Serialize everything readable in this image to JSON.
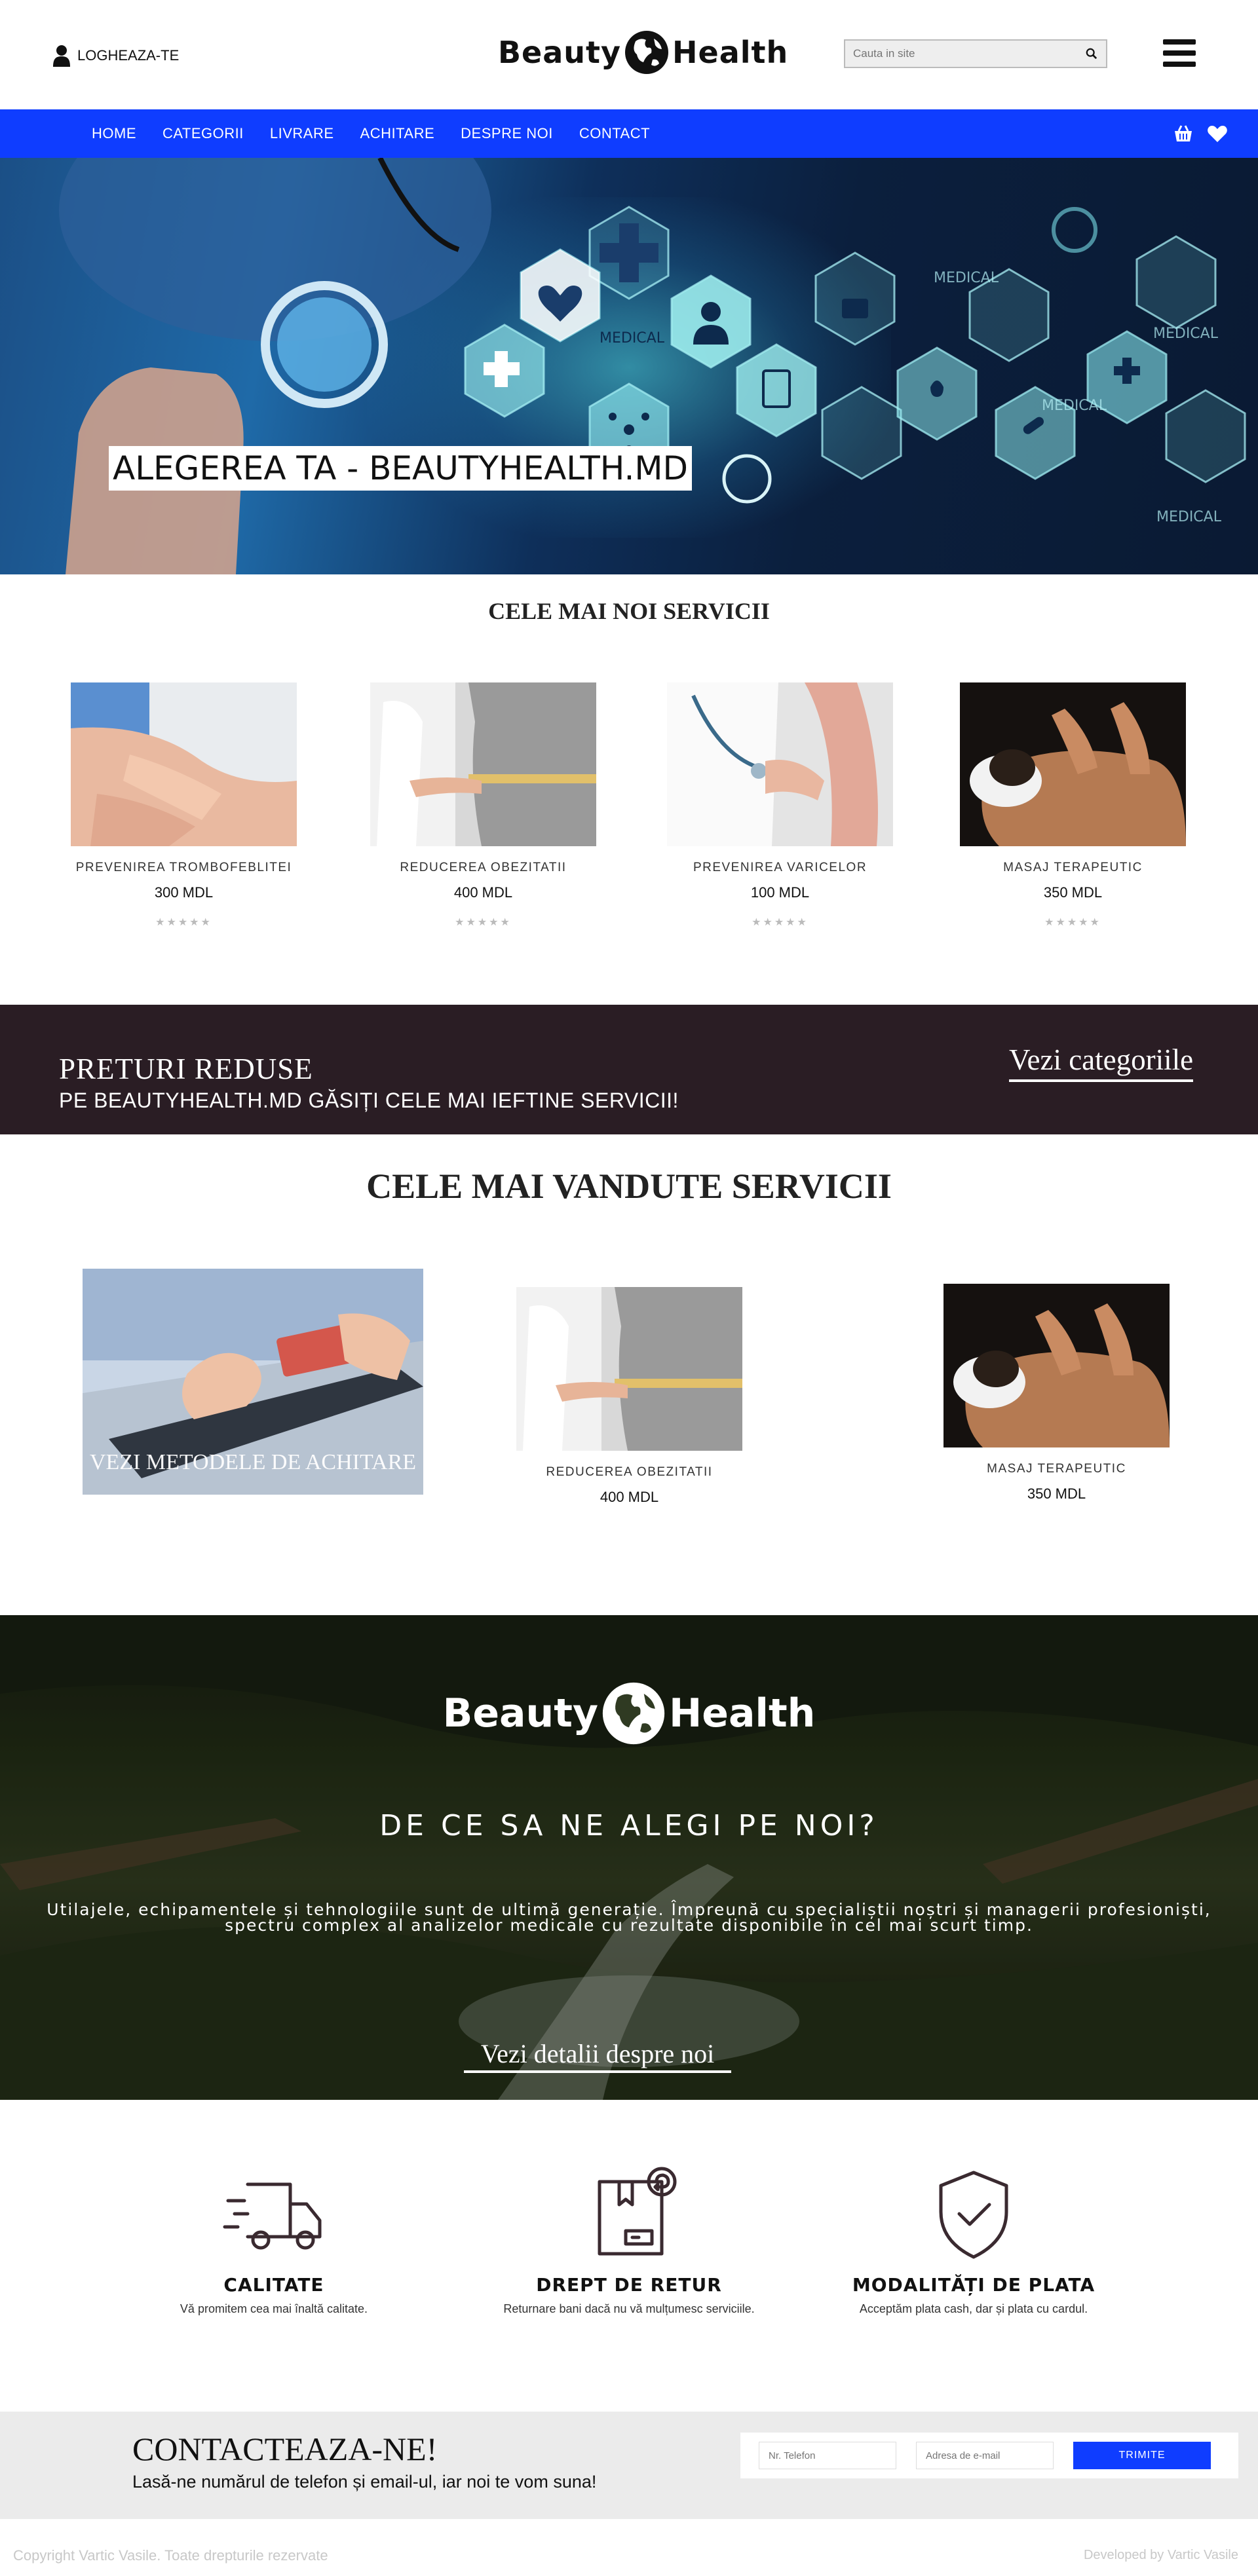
{
  "header": {
    "login_label": "LOGHEAZA-TE",
    "logo_left": "Beauty",
    "logo_right": "Health",
    "search_placeholder": "Cauta in site"
  },
  "nav": {
    "items": [
      "HOME",
      "CATEGORII",
      "LIVRARE",
      "ACHITARE",
      "DESPRE NOI",
      "CONTACT"
    ]
  },
  "hero": {
    "title": "ALEGEREA TA - BEAUTYHEALTH.MD",
    "hex_labels": [
      "MEDICAL",
      "MEDICAL",
      "MEDICAL",
      "MEDICAL",
      "MEDICAL"
    ]
  },
  "new_services": {
    "title": "CELE MAI NOI SERVICII",
    "products": [
      {
        "name": "PREVENIREA TROMBOFEBLITEI",
        "price": "300 MDL",
        "stars": "★★★★★"
      },
      {
        "name": "REDUCEREA OBEZITATII",
        "price": "400 MDL",
        "stars": "★★★★★"
      },
      {
        "name": "PREVENIREA VARICELOR",
        "price": "100 MDL",
        "stars": "★★★★★"
      },
      {
        "name": "MASAJ TERAPEUTIC",
        "price": "350 MDL",
        "stars": "★★★★★"
      }
    ]
  },
  "promo": {
    "title": "PRETURI REDUSE",
    "subtitle": "PE BEAUTYHEALTH.MD GĂSIȚI CELE MAI IEFTINE SERVICII!",
    "link": "Vezi categoriile"
  },
  "best_sellers": {
    "title": "CELE MAI VANDUTE SERVICII",
    "payment_card_label": "VEZI METODELE DE ACHITARE",
    "products": [
      {
        "name": "REDUCEREA OBEZITATII",
        "price": "400 MDL"
      },
      {
        "name": "MASAJ TERAPEUTIC",
        "price": "350 MDL"
      }
    ]
  },
  "why_us": {
    "logo_left": "Beauty",
    "logo_right": "Health",
    "title": "DE CE SA NE ALEGI PE NOI?",
    "text": "Utilajele, echipamentele și tehnologiile sunt de ultimă generație. Împreună cu specialiștii noștri și managerii profesioniști, spectru complex al analizelor medicale cu rezultate disponibile în cel mai scurt timp.",
    "link": "Vezi detalii despre noi"
  },
  "features": [
    {
      "icon": "delivery-truck-icon",
      "title": "CALITATE",
      "desc": "Vă promitem cea mai înaltă calitate."
    },
    {
      "icon": "return-box-icon",
      "title": "DREPT DE RETUR",
      "desc": "Returnare bani dacă nu vă mulțumesc serviciile."
    },
    {
      "icon": "shield-check-icon",
      "title": "MODALITĂȚI DE PLATA",
      "desc": "Acceptăm plata cash, dar și plata cu cardul."
    }
  ],
  "contact": {
    "title": "CONTACTEAZA-NE!",
    "subtitle": "Lasă-ne numărul de telefon și email-ul, iar noi te vom suna!",
    "phone_placeholder": "Nr. Telefon",
    "email_placeholder": "Adresa de e-mail",
    "submit_label": "TRIMITE"
  },
  "footer": {
    "copyright": "Copyright Vartic Vasile. Toate drepturile rezervate",
    "developer": "Developed by Vartic Vasile"
  },
  "colors": {
    "nav_blue": "#0f3dff",
    "promo_bg": "#2a1d24",
    "contact_bg": "#ebebeb"
  }
}
